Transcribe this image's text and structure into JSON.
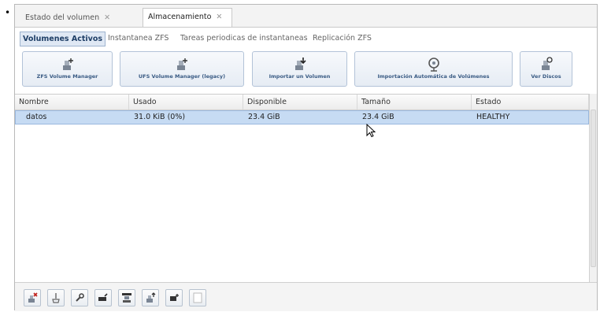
{
  "tabs": [
    {
      "label": "Estado del volumen",
      "close": "✕"
    },
    {
      "label": "Almacenamiento",
      "close": "✕"
    }
  ],
  "subtabs": [
    {
      "label": "Volumenes Activos"
    },
    {
      "label": "Instantanea ZFS"
    },
    {
      "label": "Tareas periodicas de instantaneas"
    },
    {
      "label": "Replicación ZFS"
    }
  ],
  "toolbar": [
    {
      "label": "ZFS Volume Manager",
      "icon": "volume-add-icon"
    },
    {
      "label": "UFS Volume Manager (legacy)",
      "icon": "volume-add-icon"
    },
    {
      "label": "Importar un Volumen",
      "icon": "volume-import-icon"
    },
    {
      "label": "Importación Automática de Volúmenes",
      "icon": "auto-import-icon"
    },
    {
      "label": "Ver Discos",
      "icon": "disks-icon"
    }
  ],
  "table": {
    "columns": [
      "Nombre",
      "Usado",
      "Disponible",
      "Tamaño",
      "Estado"
    ],
    "rows": [
      [
        "datos",
        "31.0 KiB (0%)",
        "23.4 GiB",
        "23.4 GiB",
        "HEALTHY"
      ]
    ]
  },
  "bottom_icons": [
    "detach-icon",
    "scrub-icon",
    "settings-wrench-icon",
    "edit-icon",
    "volume-status-icon",
    "upgrade-icon",
    "snapshot-icon",
    "blank-icon"
  ],
  "colors": {
    "accent": "#3a5b84",
    "selection": "#c6dbf3"
  }
}
